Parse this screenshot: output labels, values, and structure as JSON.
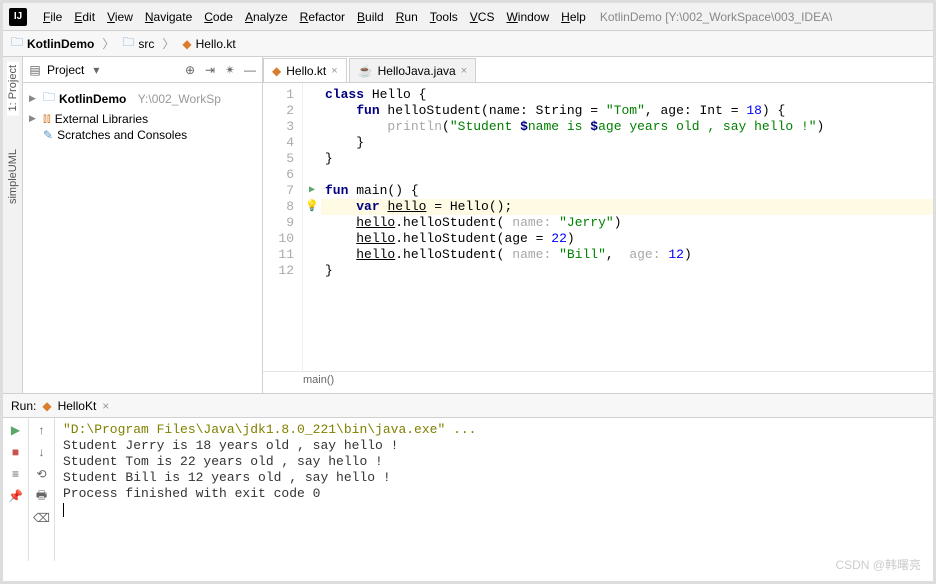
{
  "menubar": {
    "items": [
      "File",
      "Edit",
      "View",
      "Navigate",
      "Code",
      "Analyze",
      "Refactor",
      "Build",
      "Run",
      "Tools",
      "VCS",
      "Window",
      "Help"
    ],
    "title_path": "KotlinDemo [Y:\\002_WorkSpace\\003_IDEA\\"
  },
  "navbar": {
    "crumbs": [
      "KotlinDemo",
      "src",
      "Hello.kt"
    ]
  },
  "sidebar": {
    "title": "Project",
    "left_tabs": [
      "1: Project",
      "simpleUML"
    ],
    "tree": {
      "root": {
        "name": "KotlinDemo",
        "path": "Y:\\002_WorkSp"
      },
      "libs": "External Libraries",
      "scratch": "Scratches and Consoles"
    }
  },
  "editor": {
    "tabs": [
      {
        "label": "Hello.kt",
        "icon": "kt",
        "active": true
      },
      {
        "label": "HelloJava.java",
        "icon": "java",
        "active": false
      }
    ],
    "lines": [
      {
        "n": 1,
        "html": "<span class='kw'>class</span> Hello {"
      },
      {
        "n": 2,
        "html": "    <span class='kw'>fun</span> helloStudent(name: String = <span class='str'>\"Tom\"</span>, age: Int = <span class='num'>18</span>) {"
      },
      {
        "n": 3,
        "html": "        <span class='hint'>println</span>(<span class='str'>\"Student </span><span class='kw'>$</span><span class='str'>name is </span><span class='kw'>$</span><span class='str'>age years old , say hello !\"</span>)"
      },
      {
        "n": 4,
        "html": "    }"
      },
      {
        "n": 5,
        "html": "}"
      },
      {
        "n": 6,
        "html": ""
      },
      {
        "n": 7,
        "html": "<span class='kw'>fun</span> main() {",
        "mark": "run"
      },
      {
        "n": 8,
        "html": "    <span class='kw'>var</span> <span class='uvar'>hello</span> = Hello();",
        "mark": "bulb",
        "hl": true
      },
      {
        "n": 9,
        "html": "    <span class='uvar'>hello</span>.helloStudent( <span class='hint'>name:</span> <span class='str'>\"Jerry\"</span>)"
      },
      {
        "n": 10,
        "html": "    <span class='uvar'>hello</span>.helloStudent(age = <span class='num'>22</span>)"
      },
      {
        "n": 11,
        "html": "    <span class='uvar'>hello</span>.helloStudent( <span class='hint'>name:</span> <span class='str'>\"Bill\"</span>,  <span class='hint'>age:</span> <span class='num'>12</span>)"
      },
      {
        "n": 12,
        "html": "}"
      }
    ],
    "breadcrumb": "main()"
  },
  "run": {
    "label": "Run:",
    "tab": "HelloKt",
    "lines": [
      {
        "cls": "cmd",
        "text": "\"D:\\Program Files\\Java\\jdk1.8.0_221\\bin\\java.exe\" ..."
      },
      {
        "cls": "",
        "text": "Student Jerry is 18 years old , say hello !"
      },
      {
        "cls": "",
        "text": "Student Tom is 22 years old , say hello !"
      },
      {
        "cls": "",
        "text": "Student Bill is 12 years old , say hello !"
      },
      {
        "cls": "",
        "text": ""
      },
      {
        "cls": "exit",
        "text": "Process finished with exit code 0"
      }
    ]
  },
  "watermark": "CSDN @韩曙亮"
}
